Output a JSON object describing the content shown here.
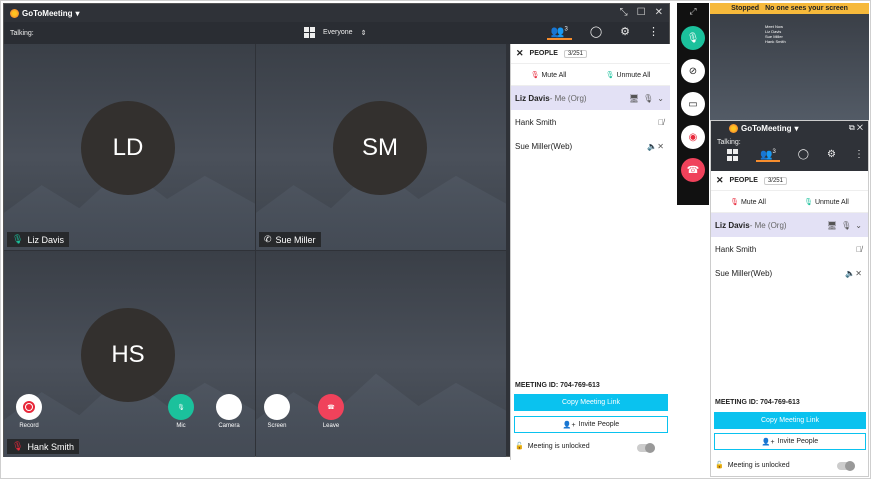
{
  "app": {
    "name": "GoToMeeting",
    "caret": "▾"
  },
  "talking": "Talking:",
  "view": {
    "label": "Everyone"
  },
  "people_count_badge": "3",
  "tiles": [
    {
      "initials": "LD",
      "name": "Liz Davis"
    },
    {
      "initials": "SM",
      "name": "Sue Miller"
    },
    {
      "initials": "HS",
      "name": "Hank Smith"
    }
  ],
  "controls": {
    "record": "Record",
    "mic": "Mic",
    "camera": "Camera",
    "screen": "Screen",
    "leave": "Leave"
  },
  "panel": {
    "title": "PEOPLE",
    "count": "3/251",
    "mute_all": "Mute All",
    "unmute_all": "Unmute All",
    "people": [
      {
        "name": "Liz Davis",
        "note": " - Me (Org)"
      },
      {
        "name": "Hank Smith",
        "note": ""
      },
      {
        "name": "Sue Miller",
        "note": " (Web)"
      }
    ],
    "meeting_id_label": "MEETING ID: 704-769-613",
    "copy_link": "Copy Meeting Link",
    "invite": "Invite People",
    "unlocked": "Meeting is unlocked"
  },
  "share_banner": {
    "stopped": "Stopped",
    "message": "No one sees your screen"
  },
  "preview_text": [
    "Meet Now",
    "Liz Davis",
    "Sue Miller",
    "Hank Smith"
  ],
  "colors": {
    "accent": "#0ac2ef",
    "mic_green": "#1bc19c",
    "leave_red": "#f0425b",
    "record_red": "#e8283a",
    "selected_row": "#e3e1f5",
    "banner": "#f6b93b"
  }
}
